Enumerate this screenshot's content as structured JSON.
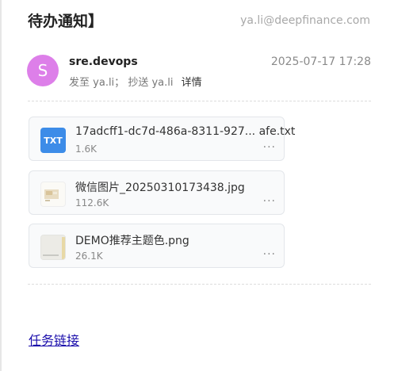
{
  "header": {
    "title": "待办通知】",
    "account": "ya.li@deepfinance.com"
  },
  "message": {
    "avatar_letter": "S",
    "sender": "sre.devops",
    "time": "2025-07-17 17:28",
    "to_label": "发至",
    "to": "ya.li",
    "separator": "；",
    "cc_label": "抄送",
    "cc": "ya.li",
    "details_label": "详情"
  },
  "attachments": [
    {
      "type_badge": "TXT",
      "name": "17adcff1-dc7d-486a-8311-927... afe.txt",
      "size": "1.6K",
      "more": "···"
    },
    {
      "name": "微信图片_20250310173438.jpg",
      "size": "112.6K",
      "more": "···"
    },
    {
      "name": "DEMO推荐主题色.png",
      "size": "26.1K",
      "more": "···"
    }
  ],
  "body": {
    "task_link": "任务链接"
  }
}
